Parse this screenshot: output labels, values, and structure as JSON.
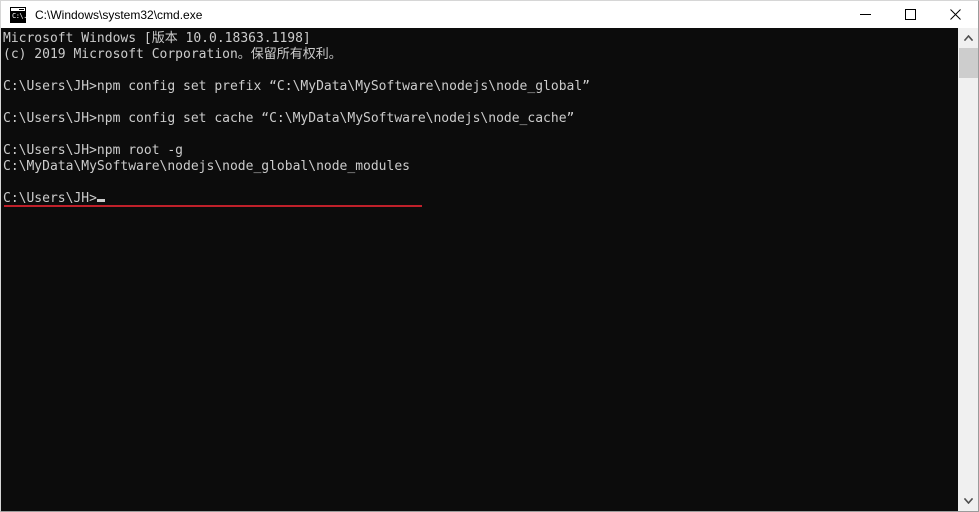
{
  "window": {
    "title": "C:\\Windows\\system32\\cmd.exe",
    "icon": "cmd-icon",
    "icon_prompt_text": "C:\\.",
    "controls": {
      "minimize_label": "—",
      "maximize_label": "□",
      "close_label": "✕"
    }
  },
  "console": {
    "background_color": "#0c0c0c",
    "foreground_color": "#cccccc",
    "lines": [
      {
        "text": "Microsoft Windows [版本 10.0.18363.1198]"
      },
      {
        "text": "(c) 2019 Microsoft Corporation。保留所有权利。"
      },
      {
        "text": ""
      },
      {
        "text": "C:\\Users\\JH>npm config set prefix “C:\\MyData\\MySoftware\\nodejs\\node_global”"
      },
      {
        "text": ""
      },
      {
        "text": "C:\\Users\\JH>npm config set cache “C:\\MyData\\MySoftware\\nodejs\\node_cache”"
      },
      {
        "text": ""
      },
      {
        "text": "C:\\Users\\JH>npm root -g"
      },
      {
        "text": "C:\\MyData\\MySoftware\\nodejs\\node_global\\node_modules"
      },
      {
        "text": ""
      },
      {
        "text": "C:\\Users\\JH>"
      }
    ],
    "prompt": "C:\\Users\\JH>",
    "cursor_visible": true
  },
  "annotation": {
    "type": "underline",
    "color": "#c0202a",
    "underlines_text": "C:\\MyData\\MySoftware\\nodejs\\node_global\\node_modules"
  },
  "scrollbar": {
    "up_arrow": "chevron-up-icon",
    "down_arrow": "chevron-down-icon",
    "thumb_position": "near-top"
  }
}
